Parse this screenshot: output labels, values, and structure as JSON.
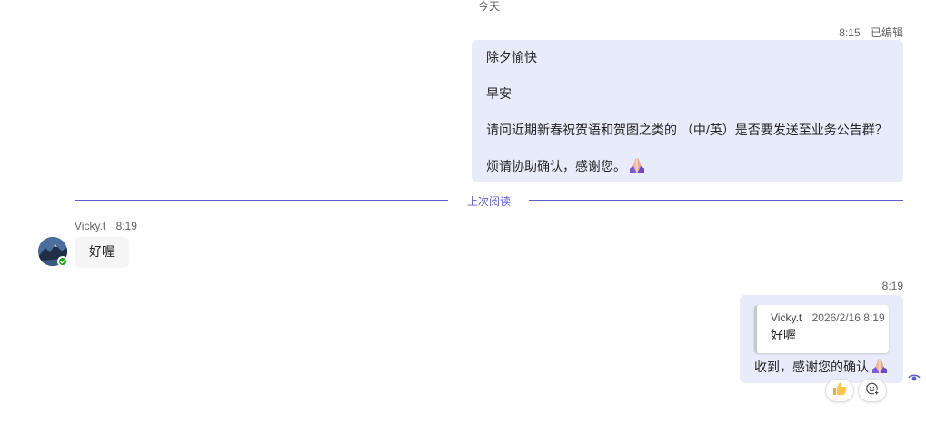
{
  "day_separator": "今天",
  "message_1": {
    "time": "8:15",
    "edited": "已编辑",
    "lines": [
      "除夕愉快",
      "早安",
      "请问近期新春祝贺语和贺图之类的 （中/英）是否要发送至业务公告群？",
      "烦请协助确认，感谢您。"
    ],
    "emoji": "folded-hands-icon"
  },
  "last_read_label": "上次阅读",
  "incoming": {
    "sender": "Vicky.t",
    "time": "8:19",
    "text": "好喔",
    "presence": "available"
  },
  "message_2": {
    "time": "8:19",
    "quote": {
      "sender": "Vicky.t",
      "date": "2026/2/16 8:19",
      "text": "好喔"
    },
    "text": "收到，感谢您的确认",
    "emoji": "folded-hands-icon"
  },
  "colors": {
    "my_bubble": "#e8ebfa",
    "their_bubble": "#f5f5f5",
    "accent": "#5b5fc7",
    "presence_green": "#13a10e"
  }
}
